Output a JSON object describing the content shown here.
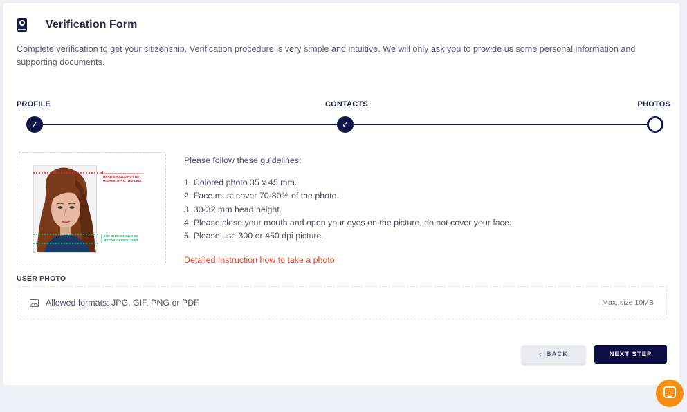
{
  "header": {
    "title": "Verification Form",
    "logo_icon": "passport-logo-icon"
  },
  "intro": "Complete verification to get your citizenship. Verification procedure is very simple and intuitive. We will only ask you to provide us some personal information and supporting documents.",
  "stepper": {
    "steps": [
      {
        "label": "PROFILE",
        "state": "completed"
      },
      {
        "label": "CONTACTS",
        "state": "completed"
      },
      {
        "label": "PHOTOS",
        "state": "current"
      }
    ],
    "check_glyph": "✓"
  },
  "photo_example": {
    "head_note": "HEAD SHOULD NOT BE HIGHER THAN THIS LINE",
    "chin_note": "THE CHIN SHOULD BE BETWEEN TWO LINES"
  },
  "guidelines": {
    "title": "Please follow these guidelines:",
    "items": [
      "1. Colored photo 35 x 45 mm.",
      "2. Face must cover 70-80% of the photo.",
      "3. 30-32 mm head height.",
      "4. Please close your mouth and open your eyes on the picture, do not cover your face.",
      "5. Please use 300 or 450 dpi picture."
    ],
    "link": "Detailed Instruction how to take a photo"
  },
  "upload": {
    "label": "USER PHOTO",
    "hint": "Allowed formats: JPG, GIF, PNG or PDF",
    "max_size": "Max. size 10MB"
  },
  "buttons": {
    "back": "BACK",
    "next": "NEXT STEP"
  },
  "colors": {
    "primary": "#0c0e45",
    "link": "#e8442a",
    "chat": "#f48f13",
    "guide_red": "#e8202a",
    "guide_green": "#1fbf6a"
  }
}
